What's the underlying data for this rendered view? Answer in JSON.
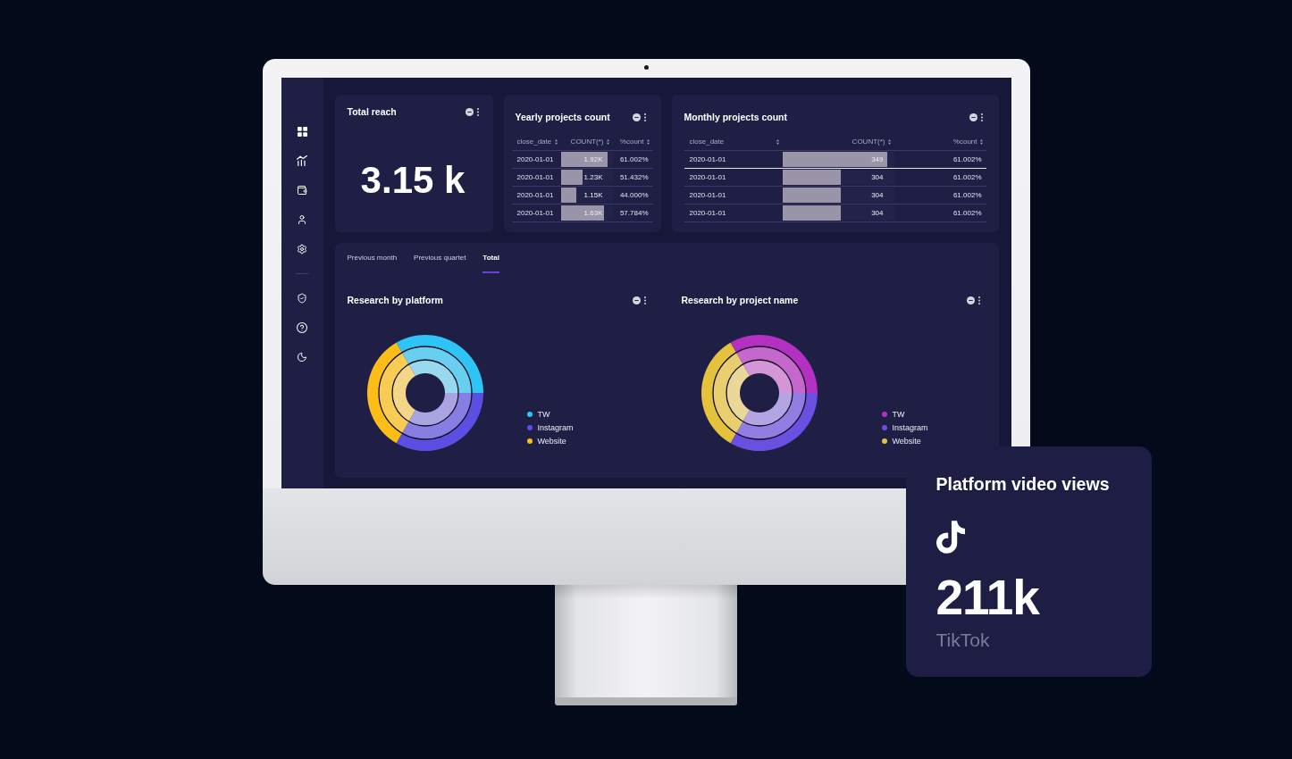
{
  "dashboard": {
    "total_reach": {
      "title": "Total reach",
      "value": "3.15 k"
    },
    "yearly_projects": {
      "title": "Yearly projects count",
      "columns": [
        "close_date",
        "COUNT(*)",
        "%count"
      ],
      "rows": [
        {
          "close_date": "2020-01-01",
          "count": "1.92K",
          "level": 0.91,
          "percent": "61.002%",
          "selected": false
        },
        {
          "close_date": "2020-01-01",
          "count": "1.23K",
          "level": 0.43,
          "percent": "51.432%",
          "selected": false
        },
        {
          "close_date": "2020-01-01",
          "count": "1.15K",
          "level": 0.3,
          "percent": "44.000%",
          "selected": false
        },
        {
          "close_date": "2020-01-01",
          "count": "1.63K",
          "level": 0.83,
          "percent": "57.784%",
          "selected": false
        }
      ]
    },
    "monthly_projects": {
      "title": "Monthly projects count",
      "columns": [
        "close_date",
        "COUNT(*)",
        "%count"
      ],
      "rows": [
        {
          "close_date": "2020-01-01",
          "count": "349",
          "level": 0.94,
          "percent": "61.002%",
          "selected": true
        },
        {
          "close_date": "2020-01-01",
          "count": "304",
          "level": 0.52,
          "percent": "61.002%",
          "selected": false
        },
        {
          "close_date": "2020-01-01",
          "count": "304",
          "level": 0.52,
          "percent": "61.002%",
          "selected": false
        },
        {
          "close_date": "2020-01-01",
          "count": "304",
          "level": 0.52,
          "percent": "61.002%",
          "selected": false
        }
      ]
    },
    "tabs": [
      {
        "label": "Previous month",
        "selected": false
      },
      {
        "label": "Previous quartet",
        "selected": false
      },
      {
        "label": "Total",
        "selected": true
      }
    ],
    "charts": [
      {
        "title": "Research by platform",
        "legend": [
          {
            "label": "TW",
            "color": "#2ec4f5"
          },
          {
            "label": "Instagram",
            "color": "#5a4fe0"
          },
          {
            "label": "Website",
            "color": "#fbbd16"
          }
        ]
      },
      {
        "title": "Research by project name",
        "legend": [
          {
            "label": "TW",
            "color": "#b330c2"
          },
          {
            "label": "Instagram",
            "color": "#6a50e0"
          },
          {
            "label": "Website",
            "color": "#e6c23c"
          }
        ]
      }
    ]
  },
  "video_views_card": {
    "title": "Platform video views",
    "value": "211k",
    "platform": "TikTok"
  }
}
